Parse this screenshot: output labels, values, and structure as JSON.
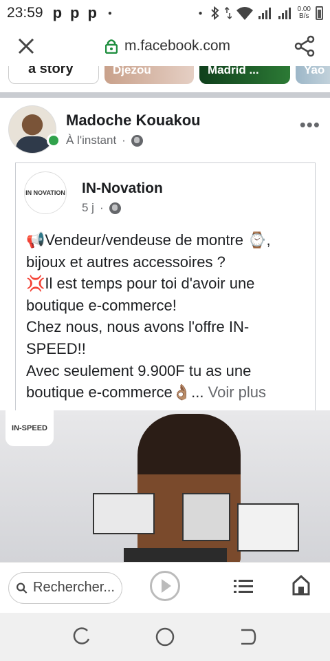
{
  "status_bar": {
    "time": "23:59",
    "notif_icons": [
      "p",
      "p",
      "p"
    ],
    "speed_value": "0.00",
    "speed_unit": "B/s"
  },
  "url_bar": {
    "url": "m.facebook.com",
    "close_icon": "close-icon",
    "share_icon": "share-icon"
  },
  "stories": {
    "create_label": "a story",
    "items": [
      {
        "label": "Djezou"
      },
      {
        "label": "Madrid ..."
      },
      {
        "label": "Yao"
      }
    ]
  },
  "post": {
    "author": "Madoche Kouakou",
    "time": "À l'instant",
    "separator": "·",
    "more_label": "•••",
    "shared": {
      "page_name": "IN-Novation",
      "page_logo_text": "IN NOVATION",
      "time": "5 j",
      "lines": [
        "📢Vendeur/vendeuse de montre ⌚,",
        "bijoux et autres accessoires ?",
        "💢Il est temps pour toi d'avoir une",
        "boutique e-commerce!",
        "Chez nous, nous avons l'offre IN-",
        "SPEED!!",
        "Avec seulement 9.900F tu as une",
        "boutique e-commerce👌🏽..."
      ],
      "see_more": "Voir plus",
      "image_badge": "IN-SPEED"
    }
  },
  "bottom_bar": {
    "search_placeholder": "Rechercher..."
  },
  "colors": {
    "online": "#31a24c",
    "meta_text": "#65676b"
  }
}
